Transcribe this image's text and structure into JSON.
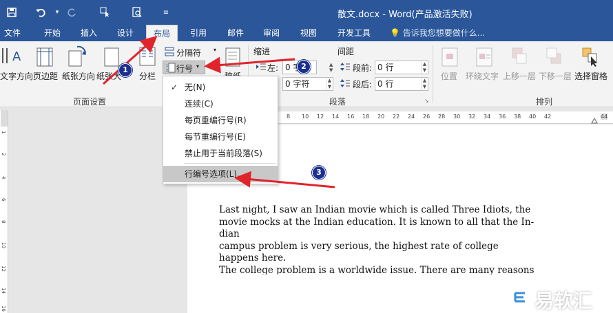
{
  "window": {
    "title": "散文.docx - Word(产品激活失败)"
  },
  "tabs": [
    {
      "label": "文件"
    },
    {
      "label": "开始"
    },
    {
      "label": "插入"
    },
    {
      "label": "设计"
    },
    {
      "label": "布局"
    },
    {
      "label": "引用"
    },
    {
      "label": "邮件"
    },
    {
      "label": "审阅"
    },
    {
      "label": "视图"
    },
    {
      "label": "开发工具"
    }
  ],
  "tell_me": "告诉我您想要做什么...",
  "ribbon": {
    "text_direction": "文字方向",
    "margins": "页边距",
    "orientation": "纸张方向",
    "size": "纸张大",
    "columns": "分栏",
    "breaks": "分隔符",
    "line_numbers": "行号",
    "hyphenation": "稿纸",
    "page_setup_group": "页面设置",
    "indent": "缩进",
    "spacing": "间距",
    "indent_left_label": "左:",
    "indent_left_value": "0 字",
    "indent_right_value": "0 字符",
    "spacing_before_label": "段前:",
    "spacing_before_value": "0 行",
    "spacing_after_label": "段后:",
    "spacing_after_value": "0 行",
    "paragraph_group": "段落",
    "position": "位置",
    "wrap_text": "环绕文字",
    "bring_forward": "上移一层",
    "send_backward": "下移一层",
    "selection_pane": "选择窗格",
    "arrange_group": "排列"
  },
  "menu": {
    "items": [
      {
        "label": "无(N)",
        "checked": true
      },
      {
        "label": "连续(C)"
      },
      {
        "label": "每页重编行号(R)"
      },
      {
        "label": "每节重编行号(E)"
      },
      {
        "label": "禁止用于当前段落(S)"
      },
      {
        "label": "行编号选项(L)..."
      }
    ]
  },
  "ruler": {
    "ticks": [
      "8",
      "10",
      "12",
      "14",
      "16",
      "18",
      "20",
      "22",
      "24",
      "26",
      "28",
      "30",
      "32",
      "34",
      "36",
      "38",
      "40",
      "42",
      "44"
    ]
  },
  "vruler": {
    "ticks": [
      "1",
      "2",
      "4",
      "6",
      "8",
      "10",
      "12",
      "14",
      "16"
    ]
  },
  "document": {
    "lines": [
      "Last night, I saw an Indian movie which is called Three Idiots, the",
      "movie mocks at the Indian education. It is known to all that the In-",
      "dian",
      "campus problem is very serious, the highest rate of college",
      "happens here.",
      "The college problem is a worldwide issue. There are many reasons"
    ]
  },
  "annotations": {
    "badges": [
      "1",
      "2",
      "3"
    ],
    "color": "#e0242b"
  },
  "watermark": {
    "text": "易软汇"
  },
  "colors": {
    "ribbon_blue": "#2b579a",
    "highlight": "#c8c8c8"
  }
}
